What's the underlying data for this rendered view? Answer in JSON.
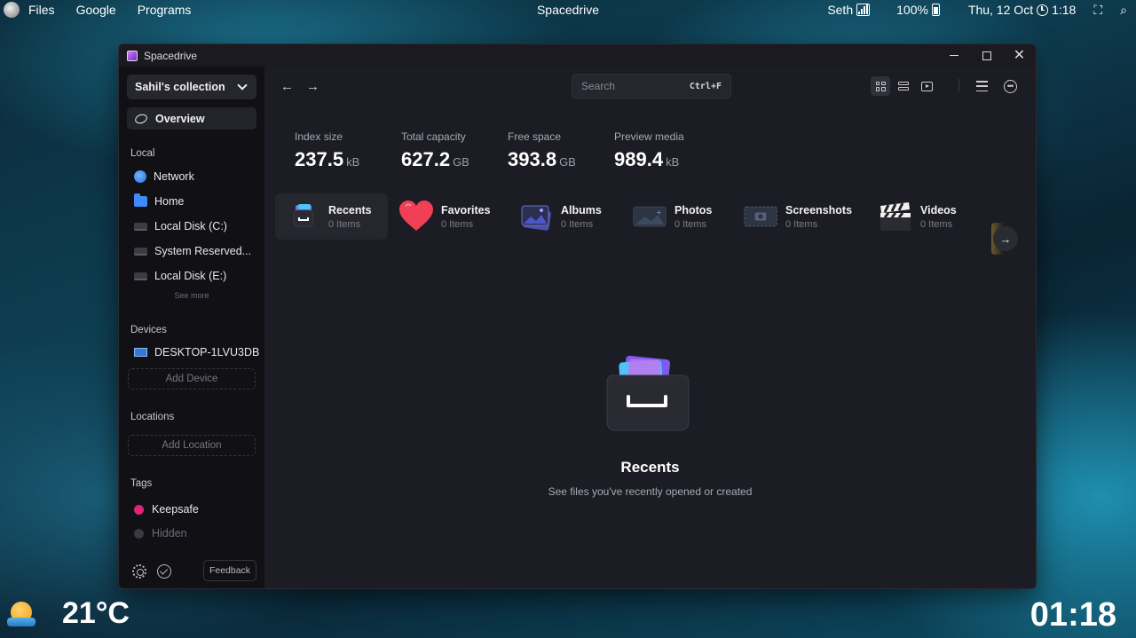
{
  "topbar": {
    "menus": [
      "Files",
      "Google",
      "Programs"
    ],
    "center_title": "Spacedrive",
    "user": "Seth",
    "battery": "100%",
    "datetime": "Thu, 12 Oct",
    "time": "1:18"
  },
  "window": {
    "title": "Spacedrive",
    "accent": "#9b5de5"
  },
  "sidebar": {
    "collection": "Sahil's collection",
    "overview": "Overview",
    "local_title": "Local",
    "local_items": [
      "Network",
      "Home",
      "Local Disk (C:)",
      "System Reserved...",
      "Local Disk (E:)"
    ],
    "see_more": "See more",
    "devices_title": "Devices",
    "device": "DESKTOP-1LVU3DB",
    "add_device": "Add Device",
    "locations_title": "Locations",
    "add_location": "Add Location",
    "tags_title": "Tags",
    "tags": [
      {
        "label": "Keepsafe",
        "color": "#e0247a"
      },
      {
        "label": "Hidden",
        "color": "#3a3a42"
      }
    ],
    "feedback": "Feedback"
  },
  "toolbar": {
    "search_placeholder": "Search",
    "search_shortcut": "Ctrl+F"
  },
  "stats": [
    {
      "label": "Index size",
      "value": "237.5",
      "unit": "kB"
    },
    {
      "label": "Total capacity",
      "value": "627.2",
      "unit": "GB"
    },
    {
      "label": "Free space",
      "value": "393.8",
      "unit": "GB"
    },
    {
      "label": "Preview media",
      "value": "989.4",
      "unit": "kB"
    }
  ],
  "categories": [
    {
      "name": "Recents",
      "count": "0 Items",
      "icon": "recents-icon"
    },
    {
      "name": "Favorites",
      "count": "0 Items",
      "icon": "heart-icon"
    },
    {
      "name": "Albums",
      "count": "0 Items",
      "icon": "albums-icon"
    },
    {
      "name": "Photos",
      "count": "0 Items",
      "icon": "photos-icon"
    },
    {
      "name": "Screenshots",
      "count": "0 Items",
      "icon": "screenshots-icon"
    },
    {
      "name": "Videos",
      "count": "0 Items",
      "icon": "clapperboard-icon"
    }
  ],
  "empty_state": {
    "title": "Recents",
    "subtitle": "See files you've recently opened or created"
  },
  "desktop": {
    "temperature": "21°C",
    "clock": "01:18"
  }
}
